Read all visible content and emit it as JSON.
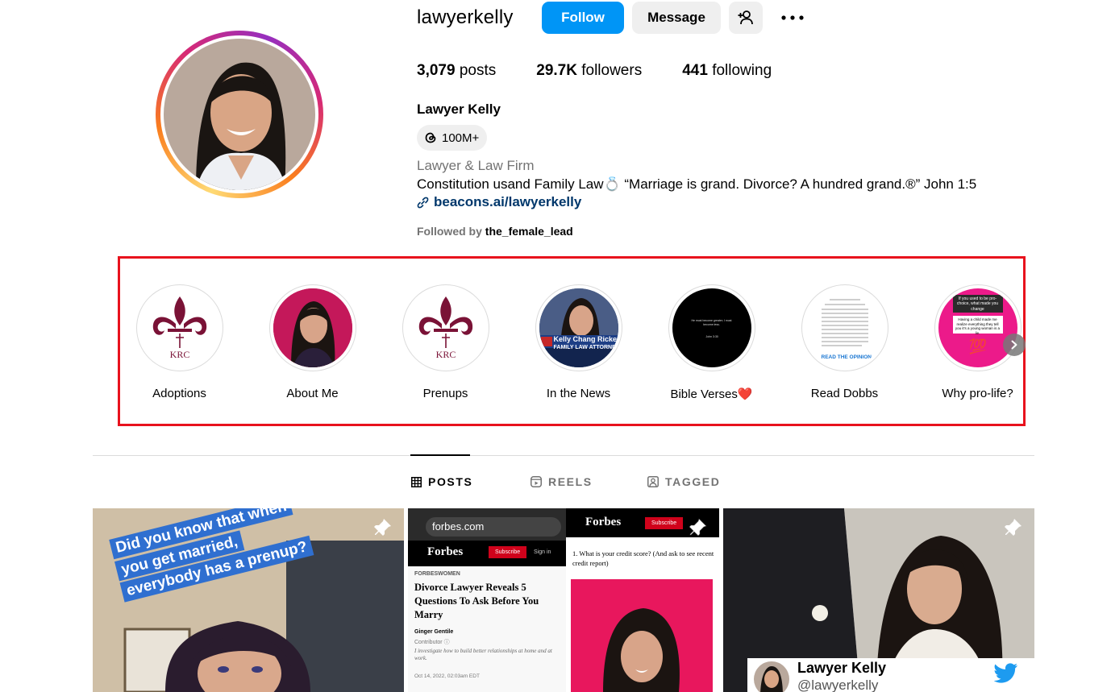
{
  "profile": {
    "username": "lawyerkelly",
    "follow_label": "Follow",
    "message_label": "Message",
    "stats": {
      "posts_count": "3,079",
      "posts_label": "posts",
      "followers_count": "29.7K",
      "followers_label": "followers",
      "following_count": "441",
      "following_label": "following"
    },
    "full_name": "Lawyer Kelly",
    "threads_count": "100M+",
    "category": "Lawyer & Law Firm",
    "bio": "Constitution usand Family Law💍 “Marriage is grand. Divorce? A hundred grand.®” John 1:5",
    "link": "beacons.ai/lawyerkelly",
    "followed_by_prefix": "Followed by",
    "followed_by_user": "the_female_lead"
  },
  "highlights": [
    {
      "label": "Adoptions"
    },
    {
      "label": "About Me"
    },
    {
      "label": "Prenups"
    },
    {
      "label": "In the News",
      "caption": "Kelly Chang Ricker",
      "subcaption": "FAMILY LAW ATTORNE"
    },
    {
      "label": "Bible Verses❤️",
      "verse": "He must become greater; I must become less.",
      "ref": "John 3:30"
    },
    {
      "label": "Read Dobbs",
      "caption": "READ THE OPINION"
    },
    {
      "label": "Why pro-life?",
      "q1": "If you used to be pro-choice, what made you change",
      "q2": "Having a child made me realize everything they tell you it's a young woman is a lie.",
      "emoji": "💯"
    }
  ],
  "tabs": {
    "posts": "POSTS",
    "reels": "REELS",
    "tagged": "TAGGED"
  },
  "posts": [
    {
      "caption": "Did you know that when you get married, everybody has a prenup?"
    },
    {
      "url": "forbes.com",
      "brand": "Forbes",
      "subscribe": "Subscribe",
      "signin": "Sign in",
      "section": "FORBESWOMEN",
      "headline": "Divorce Lawyer Reveals 5 Questions To Ask Before You Marry",
      "author": "Ginger Gentile",
      "author_role": "Contributor ⓘ",
      "author_bio": "I investigate how to build better relationships at home and at work.",
      "date": "Oct 14, 2022, 02:03am EDT",
      "question": "1. What is your credit score? (And ask to see recent credit report)"
    },
    {
      "tweet_name": "Lawyer Kelly",
      "tweet_handle": "@lawyerkelly"
    }
  ],
  "colors": {
    "follow_blue": "#0095f6",
    "link_blue": "#00376b",
    "highlight_box_red": "#e8121d",
    "muted_gray": "#737373",
    "krc_maroon": "#7a1236"
  }
}
